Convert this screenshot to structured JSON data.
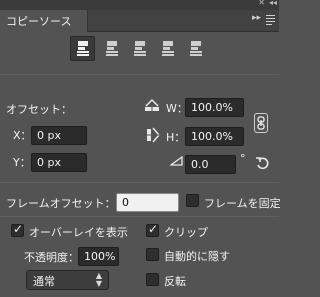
{
  "panel": {
    "title": "コピーソース",
    "offset_label": "オフセット：",
    "x_label": "X：",
    "x_value": "0 px",
    "y_label": "Y：",
    "y_value": "0 px",
    "w_label": "W：",
    "w_value": "100.0%",
    "h_label": "H：",
    "h_value": "100.0%",
    "angle_value": "0.0",
    "degree_symbol": "°",
    "frame_offset_label": "フレームオフセット：",
    "frame_offset_value": "0",
    "lock_frame_label": "フレームを固定",
    "show_overlay_label": "オーバーレイを表示",
    "clip_label": "クリップ",
    "opacity_label": "不透明度：",
    "opacity_value": "100%",
    "auto_hide_label": "自動的に隠す",
    "blend_mode_value": "通常",
    "invert_label": "反転"
  },
  "checkboxes": {
    "lock_frame": false,
    "show_overlay": true,
    "clip": true,
    "auto_hide": false,
    "invert": false
  },
  "icons": [
    "close-icon",
    "collapse-icon",
    "panel-menu-icon",
    "clone-source-icon",
    "flip-horizontal-icon",
    "flip-vertical-icon",
    "link-icon",
    "angle-icon",
    "reset-icon"
  ]
}
